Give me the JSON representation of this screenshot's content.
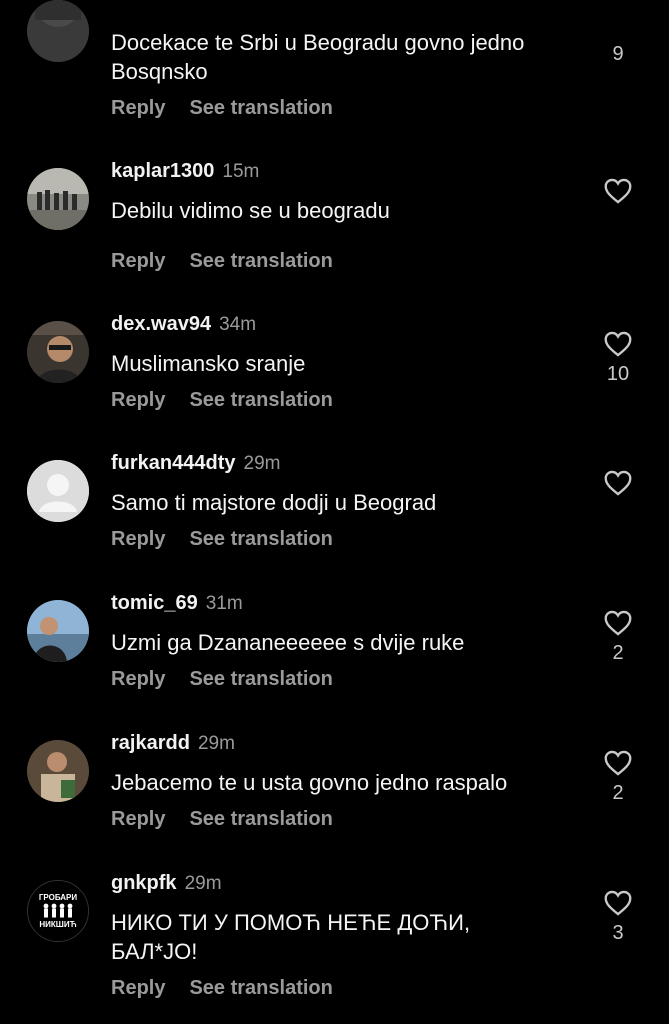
{
  "actions": {
    "reply": "Reply",
    "translate": "See translation"
  },
  "comments": [
    {
      "username": "",
      "time": "",
      "text": "Docekace te Srbi u Beogradu govno jedno Bosqnsko",
      "likes": "9"
    },
    {
      "username": "kaplar1300",
      "time": "15m",
      "text": "Debilu vidimo se u beogradu",
      "likes": ""
    },
    {
      "username": "dex.wav94",
      "time": "34m",
      "text": "Muslimansko sranje",
      "likes": "10"
    },
    {
      "username": "furkan444dty",
      "time": "29m",
      "text": "Samo ti majstore dodji u Beograd",
      "likes": ""
    },
    {
      "username": "tomic_69",
      "time": "31m",
      "text": "Uzmi ga Dzananeeeeee s dvije ruke",
      "likes": "2"
    },
    {
      "username": "rajkardd",
      "time": "29m",
      "text": "Jebacemo te u usta govno jedno raspalo",
      "likes": "2"
    },
    {
      "username": "gnkpfk",
      "time": "29m",
      "text": "НИКО ТИ У ПОМОЋ НЕЋЕ ДОЋИ, БАЛ*ЈО!",
      "likes": "3"
    }
  ],
  "avatar_logo": {
    "line1": "ГРОБАРИ",
    "line2": "НИКШИЋ"
  }
}
